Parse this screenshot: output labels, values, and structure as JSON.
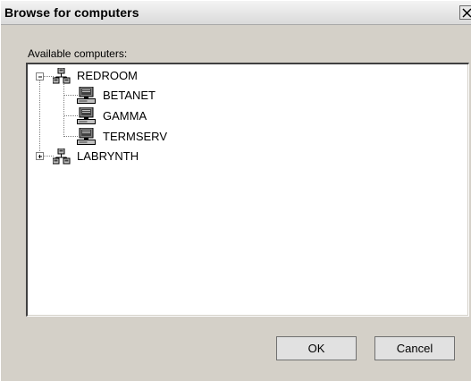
{
  "dialog": {
    "title": "Browse for computers",
    "close_glyph": "✕",
    "available_label": "Available computers:"
  },
  "tree": [
    {
      "label": "REDROOM",
      "icon": "network-group-icon",
      "expander": "minus",
      "level": 0,
      "children": [
        {
          "label": "BETANET",
          "icon": "computer-icon"
        },
        {
          "label": "GAMMA",
          "icon": "computer-icon"
        },
        {
          "label": "TERMSERV",
          "icon": "computer-icon"
        }
      ]
    },
    {
      "label": "LABRYNTH",
      "icon": "network-group-icon",
      "expander": "plus",
      "level": 0,
      "children": []
    }
  ],
  "buttons": {
    "ok": "OK",
    "cancel": "Cancel"
  }
}
